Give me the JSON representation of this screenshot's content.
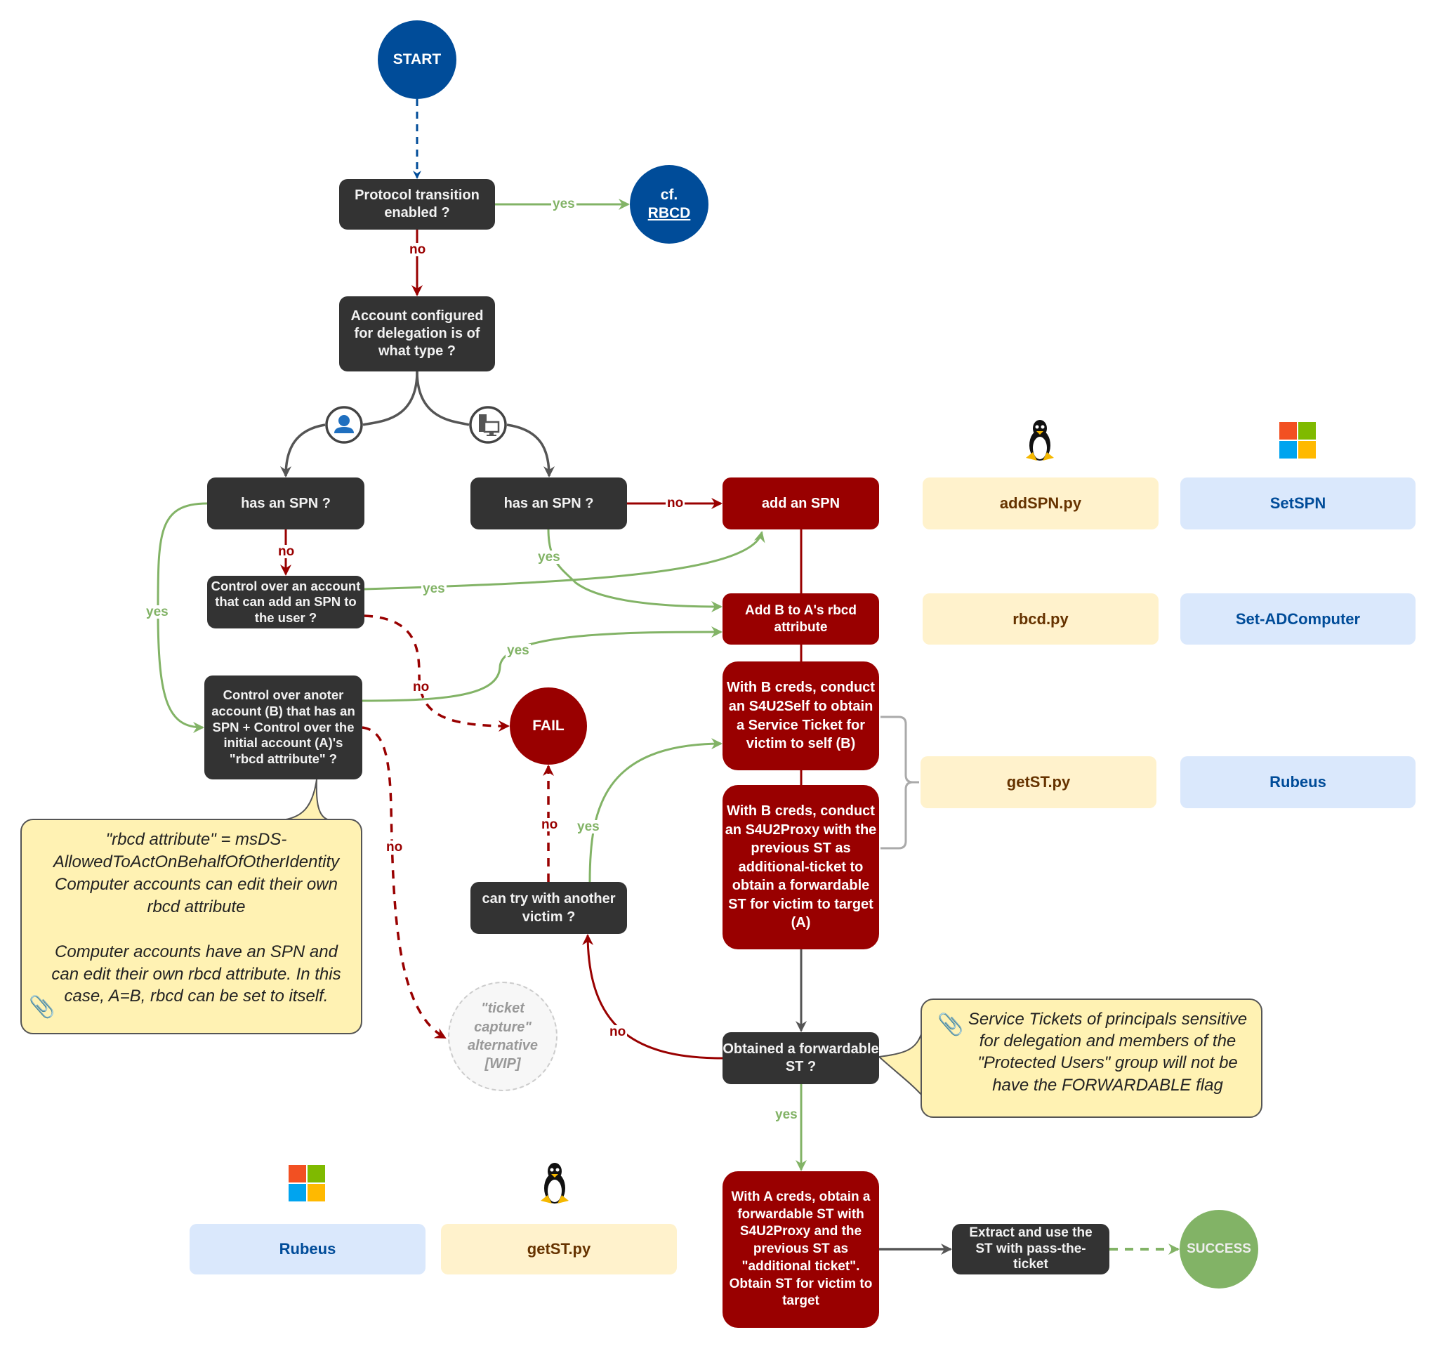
{
  "start": {
    "label": "START"
  },
  "protocol_transition": {
    "label": "Protocol transition enabled ?"
  },
  "cf_rbcd": {
    "prefix": "cf.",
    "link": "RBCD"
  },
  "account_type": {
    "label": "Account configured for delegation is of what type ?"
  },
  "branch_icons": {
    "user": "user-account-icon",
    "computer": "computer-account-icon"
  },
  "user_branch": {
    "has_spn": "has an SPN ?",
    "control_add_spn": "Control over an account that can add an SPN to the user ?",
    "control_other": "Control over anoter account (B) that has an SPN + Control over the initial account (A)'s \"rbcd attribute\" ?"
  },
  "computer_branch": {
    "has_spn": "has an SPN ?"
  },
  "actions": {
    "add_spn": "add an SPN",
    "add_rbcd": "Add B to A's rbcd attribute",
    "s4u2self": "With B creds, conduct an S4U2Self to obtain a Service Ticket for victim to self (B)",
    "s4u2proxy": "With B creds, conduct an S4U2Proxy with the previous ST as additional-ticket to obtain a forwardable ST for victim to target (A)",
    "final_s4u2proxy": "With A creds, obtain a forwardable ST with S4U2Proxy and the previous ST as \"additional ticket\". Obtain ST for victim to target",
    "pass_the_ticket": "Extract and use the ST with pass-the-ticket"
  },
  "decisions": {
    "obtained_forwardable": "Obtained a forwardable ST ?",
    "try_another_victim": "can try with another victim ?"
  },
  "terminals": {
    "fail": "FAIL",
    "success": "SUCCESS",
    "wip": "\"ticket capture\" alternative [WIP]"
  },
  "tools": {
    "linux_icon": "linux-tux-icon",
    "windows_icon": "windows-logo-icon",
    "add_spn": {
      "linux": "addSPN.py",
      "windows": "SetSPN"
    },
    "add_rbcd": {
      "linux": "rbcd.py",
      "windows": "Set-ADComputer"
    },
    "get_st": {
      "linux": "getST.py",
      "windows": "Rubeus"
    },
    "final": {
      "windows": "Rubeus",
      "linux": "getST.py"
    }
  },
  "notes": {
    "rbcd_note": {
      "p1": "\"rbcd attribute\" = msDS-AllowedToActOnBehalfOfOtherIdentity Computer accounts can edit their own rbcd attribute",
      "p2": "Computer accounts have an SPN and can edit their own rbcd attribute. In this case, A=B, rbcd can be set to itself."
    },
    "forwardable_note": "Service Tickets of principals sensitive for delegation and members of the \"Protected Users\" group will not be have the FORWARDABLE flag"
  },
  "edge_labels": {
    "yes": "yes",
    "no": "no"
  },
  "colors": {
    "dark": "#333333",
    "red": "#990000",
    "blue": "#004c99",
    "green": "#82b366",
    "note": "#fff2b3",
    "linux_tool": "#fff2cc",
    "windows_tool": "#dae8fc"
  }
}
